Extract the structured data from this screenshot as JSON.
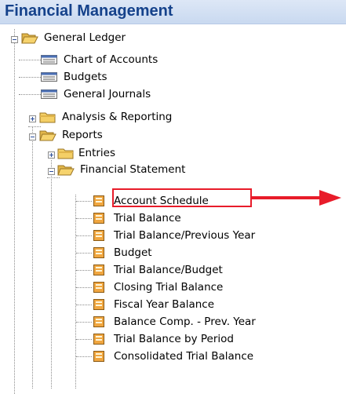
{
  "header": {
    "title": "Financial Management"
  },
  "tree": {
    "general_ledger": "General Ledger",
    "chart_of_accounts": "Chart of Accounts",
    "budgets": "Budgets",
    "general_journals": "General Journals",
    "analysis_reporting": "Analysis & Reporting",
    "reports": "Reports",
    "entries": "Entries",
    "financial_statement": "Financial Statement",
    "report_items": [
      "Account Schedule",
      "Trial Balance",
      "Trial Balance/Previous Year",
      "Budget",
      "Trial Balance/Budget",
      "Closing Trial Balance",
      "Fiscal Year Balance",
      "Balance Comp. - Prev. Year",
      "Trial Balance by Period",
      "Consolidated Trial Balance"
    ]
  },
  "highlight": {
    "color": "#e81c2a",
    "target": "Account Schedule"
  },
  "icons": {
    "folder": "folder-icon",
    "open_folder": "folder-open-icon",
    "list": "list-window-icon",
    "report": "report-icon",
    "expand": "expand-toggle",
    "collapse": "collapse-toggle"
  }
}
